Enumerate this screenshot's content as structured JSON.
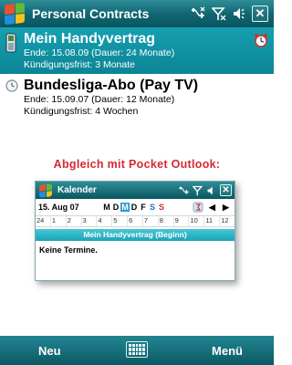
{
  "app": {
    "title": "Personal Contracts"
  },
  "contracts": [
    {
      "title": "Mein Handyvertrag",
      "end_line": "Ende: 15.08.09 (Dauer: 24 Monate)",
      "notice_line": "Kündigungsfrist: 3 Monate",
      "selected": true,
      "icon": "phone-icon",
      "alarm_icon": "alarm-clock-icon"
    },
    {
      "title": "Bundesliga-Abo (Pay TV)",
      "end_line": "Ende: 15.09.07 (Dauer: 12 Monate)",
      "notice_line": "Kündigungsfrist: 4 Wochen",
      "selected": false,
      "icon": "clock-icon"
    }
  ],
  "promo": "Abgleich mit Pocket Outlook:",
  "calendar": {
    "title": "Kalender",
    "date": "15. Aug 07",
    "weekdays": [
      "M",
      "D",
      "M",
      "D",
      "F",
      "S",
      "S"
    ],
    "active_weekday_index": 2,
    "hours": [
      "24",
      "1",
      "2",
      "3",
      "4",
      "5",
      "6",
      "7",
      "8",
      "9",
      "10",
      "11",
      "12"
    ],
    "event": "Mein Handyvertrag (Beginn)",
    "empty_text": "Keine Termine."
  },
  "menu": {
    "left": "Neu",
    "right": "Menü"
  },
  "colors": {
    "titlebar": "#0f6470",
    "selection": "#0c8595",
    "promo": "#d8282f",
    "event": "#1aa5b8"
  }
}
